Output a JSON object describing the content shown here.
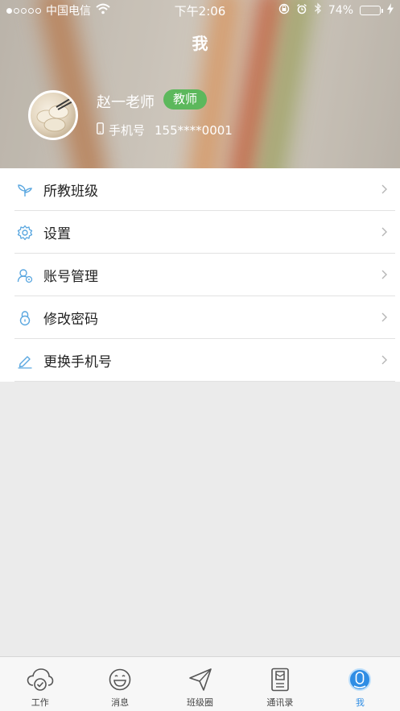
{
  "status_bar": {
    "carrier": "中国电信",
    "time": "下午2:06",
    "battery_percent": "74%",
    "battery_level": 0.74,
    "signal_dots_filled": 1,
    "icons": [
      "signal-dots-icon",
      "wifi-icon",
      "rotation-lock-icon",
      "alarm-icon",
      "bluetooth-icon",
      "battery-icon",
      "charging-icon"
    ]
  },
  "header": {
    "title": "我",
    "user_name": "赵一老师",
    "role": "教师",
    "phone_label": "手机号",
    "phone_value": "155****0001"
  },
  "menu": {
    "items": [
      {
        "label": "所教班级",
        "icon": "sprout-icon"
      },
      {
        "label": "设置",
        "icon": "gear-icon"
      },
      {
        "label": "账号管理",
        "icon": "account-icon"
      },
      {
        "label": "修改密码",
        "icon": "lock-icon"
      },
      {
        "label": "更换手机号",
        "icon": "pencil-icon"
      }
    ]
  },
  "tabbar": {
    "items": [
      {
        "label": "工作",
        "icon": "cloud-check-icon"
      },
      {
        "label": "消息",
        "icon": "smile-bubble-icon"
      },
      {
        "label": "班级圈",
        "icon": "paper-plane-icon"
      },
      {
        "label": "通讯录",
        "icon": "address-book-icon"
      },
      {
        "label": "我",
        "icon": "user-icon",
        "active": true
      }
    ]
  },
  "colors": {
    "accent": "#2f8de4",
    "badge": "#5cb85c",
    "icon_blue": "#5aa7e0",
    "page_bg": "#ebebeb"
  }
}
